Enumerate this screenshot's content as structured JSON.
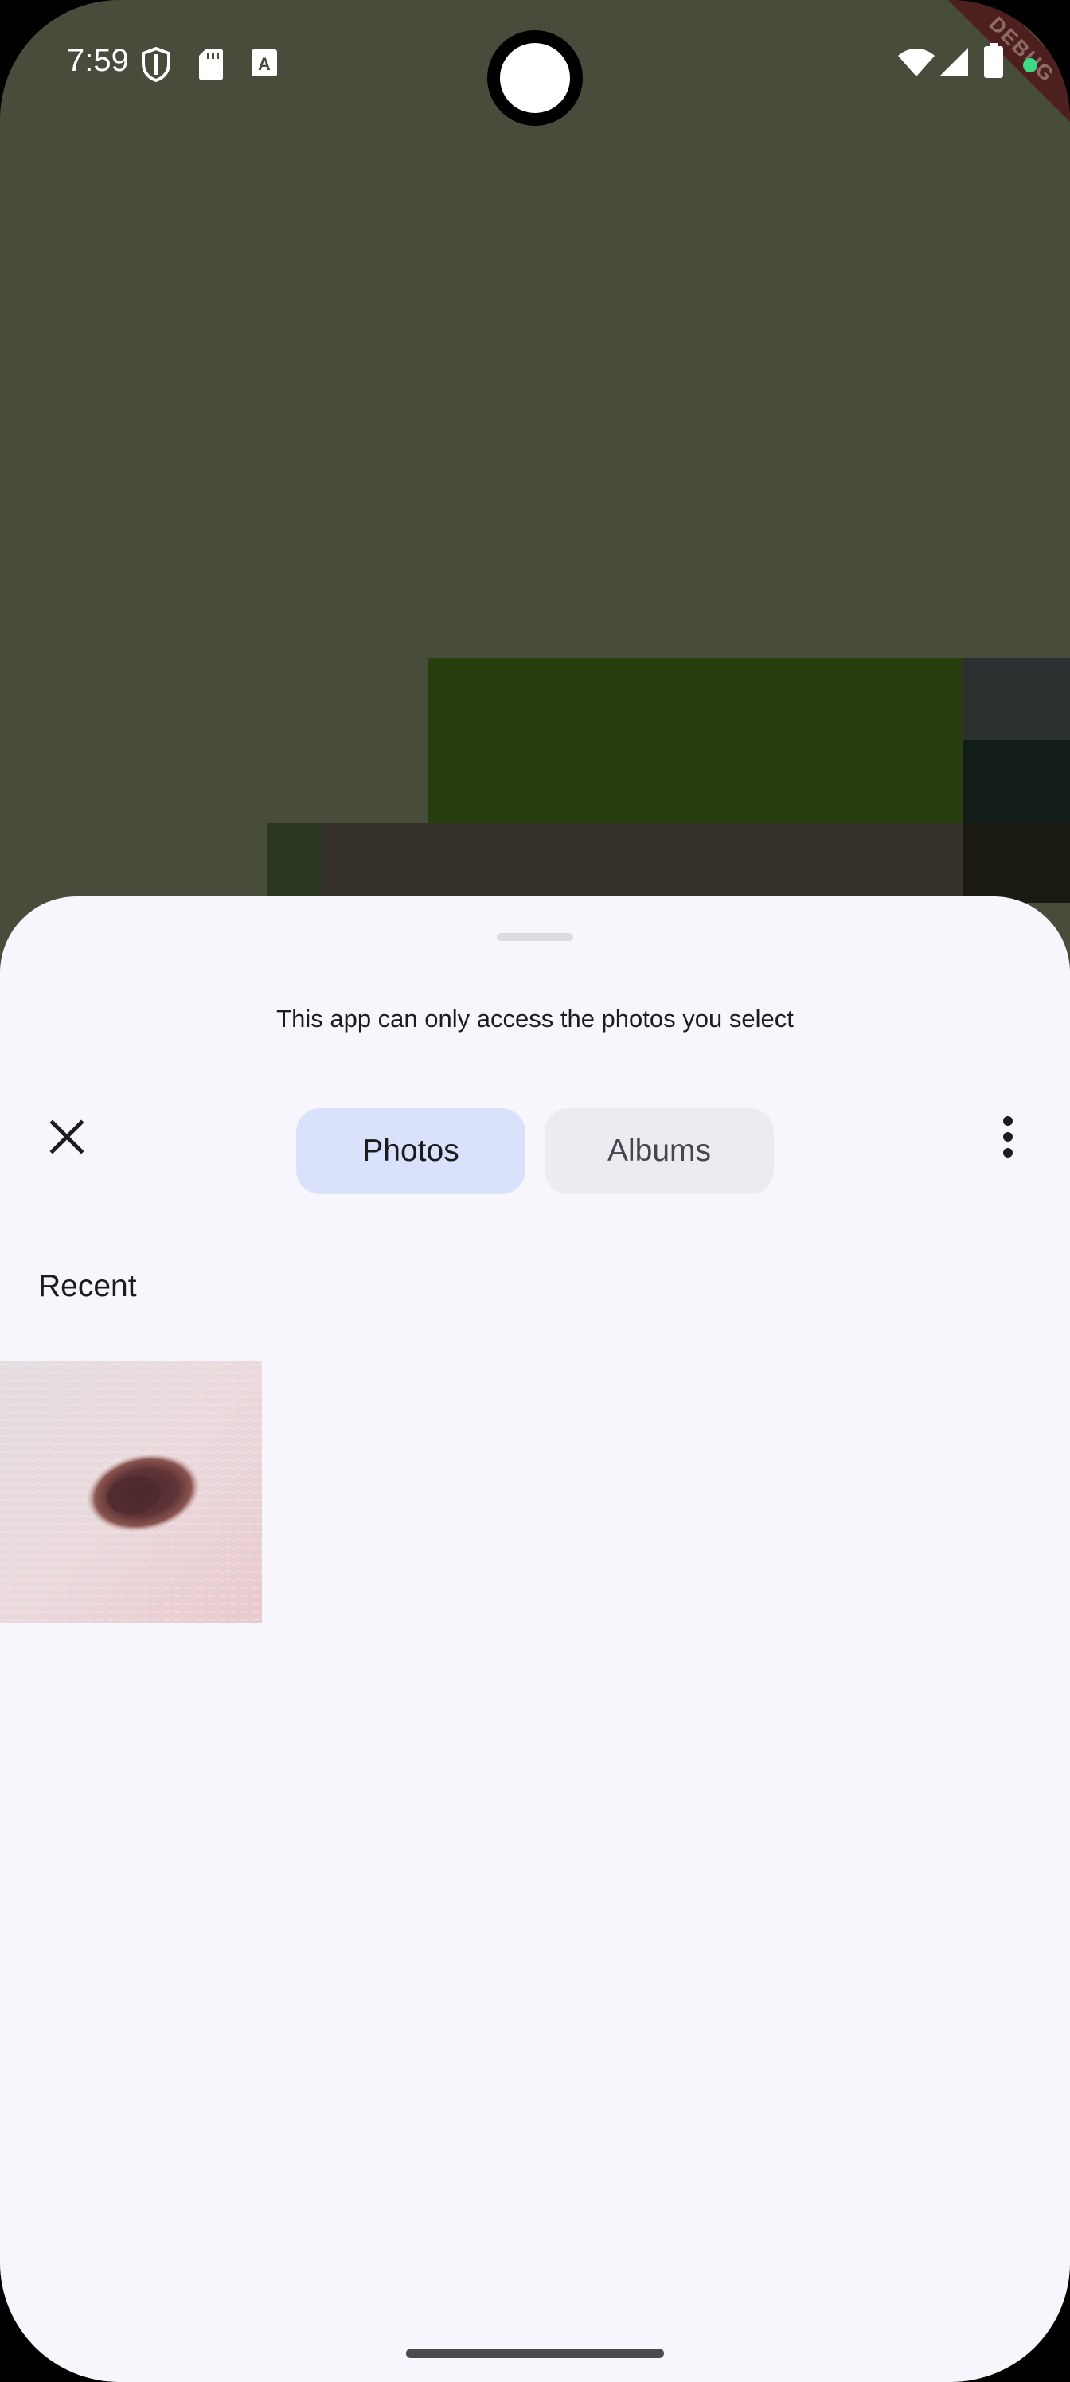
{
  "status_bar": {
    "time": "7:59",
    "left_icons": [
      "vpn-shield-icon",
      "sd-card-icon",
      "font-a-icon"
    ],
    "right_icons": [
      "wifi-icon",
      "cellular-signal-icon",
      "battery-icon"
    ],
    "debug_banner": "DEBUG"
  },
  "picker": {
    "notice": "This app can only access the photos you select",
    "close_icon": "close-icon",
    "tabs": [
      {
        "label": "Photos",
        "selected": true
      },
      {
        "label": "Albums",
        "selected": false
      }
    ],
    "more_icon": "more-vertical-icon",
    "section_title": "Recent",
    "photos": [
      {
        "subject": "skin-mole-photo"
      }
    ]
  },
  "colors": {
    "sheet_background": "#f7f6fc",
    "selected_tab": "#dae2fb",
    "unselected_tab": "#ebebf0",
    "background_app": "#474c3b"
  }
}
